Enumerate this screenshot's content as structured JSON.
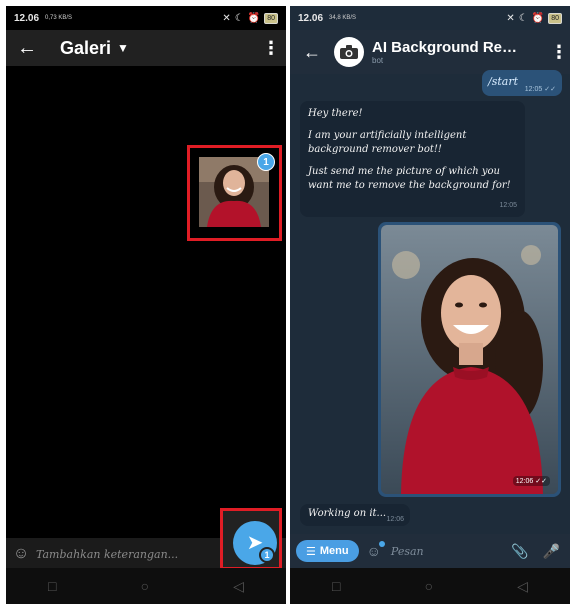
{
  "left": {
    "status": {
      "time": "12.06",
      "net": "0,73 KB/S",
      "battery": "80"
    },
    "header": {
      "title": "Galeri",
      "back_icon": "arrow-left-icon",
      "more_icon": "more-vert-icon"
    },
    "selected_thumb": {
      "badge": "1"
    },
    "caption": {
      "placeholder": "Tambahkan keterangan..."
    },
    "send": {
      "count": "1"
    }
  },
  "right": {
    "status": {
      "time": "12.06",
      "net": "34,8 KB/S",
      "battery": "80"
    },
    "header": {
      "name": "AI Background Remover",
      "sub": "bot"
    },
    "messages": {
      "start": {
        "text": "/start",
        "time": "12:05"
      },
      "intro": {
        "line1": "Hey there!",
        "line2": "I am your artificially intelligent background remover bot!!",
        "line3": "Just send me the picture of which you want me to remove the background for!",
        "time": "12:05"
      },
      "photo": {
        "time": "12:06"
      },
      "working": {
        "text": "Working on it...",
        "time": "12:06"
      }
    },
    "input": {
      "menu_label": "Menu",
      "placeholder": "Pesan"
    }
  },
  "colors": {
    "accent": "#4aa7e8",
    "highlight": "#e01d25",
    "chat_bg": "#1e2c3a",
    "out_bubble": "#2b5278",
    "in_bubble": "#182533"
  }
}
